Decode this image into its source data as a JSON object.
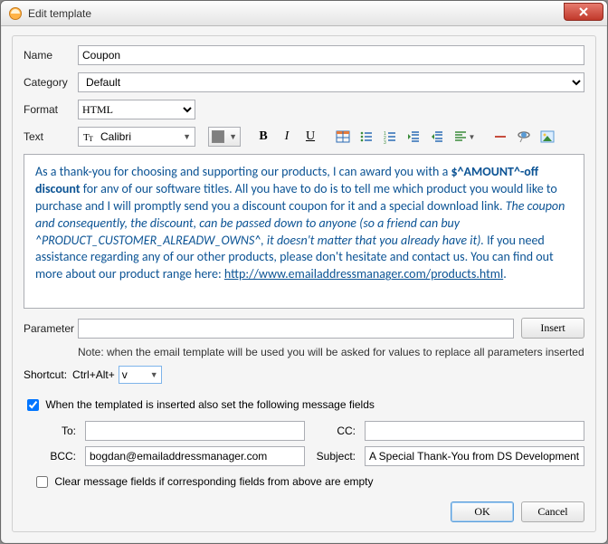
{
  "window": {
    "title": "Edit template"
  },
  "labels": {
    "name": "Name",
    "category": "Category",
    "format": "Format",
    "text": "Text",
    "parameter": "Parameter",
    "insert": "Insert",
    "note": "Note: when the email template will be used you will be asked for values to replace all parameters inserted",
    "shortcut_prefix": "Shortcut:",
    "shortcut_keys": "Ctrl+Alt+",
    "also_set": "When the templated is inserted also set the following message fields",
    "to": "To:",
    "cc": "CC:",
    "bcc": "BCC:",
    "subject": "Subject:",
    "clear_fields": "Clear message fields if corresponding fields from above are empty",
    "ok": "OK",
    "cancel": "Cancel"
  },
  "values": {
    "name": "Coupon",
    "category": "Default",
    "format": "HTML",
    "font": "Calibri",
    "parameter": "",
    "shortcut_key": "v",
    "also_set_checked": true,
    "to": "",
    "cc": "",
    "bcc": "bogdan@emailaddressmanager.com",
    "subject": "A Special Thank-You from DS Development",
    "clear_fields_checked": false
  },
  "editor": {
    "line1_a": "As a thank-you for choosing and supporting our products, I can award you with a ",
    "amount_token": "$^AMOUNT^-off discount",
    "line1_b": " for anv of our software titles. All you have to do is to tell me which product you would like to purchase and I will promptly send you a discount coupon for it and a special download link. ",
    "italic_part": "The coupon and consequently, the discount, can be passed down to anyone (so a friend can buy ^PRODUCT_CUSTOMER_ALREADW_OWNS^, it doesn't matter that you already have it).",
    "line2": " If you need assistance regarding any of our other products, please don't hesitate and contact us. You can find out more about our product range here: ",
    "url": "http://www.emailaddressmanager.com/products.html",
    "dot": "."
  },
  "icons": {
    "bold": "B",
    "italic": "I",
    "underline": "U"
  }
}
